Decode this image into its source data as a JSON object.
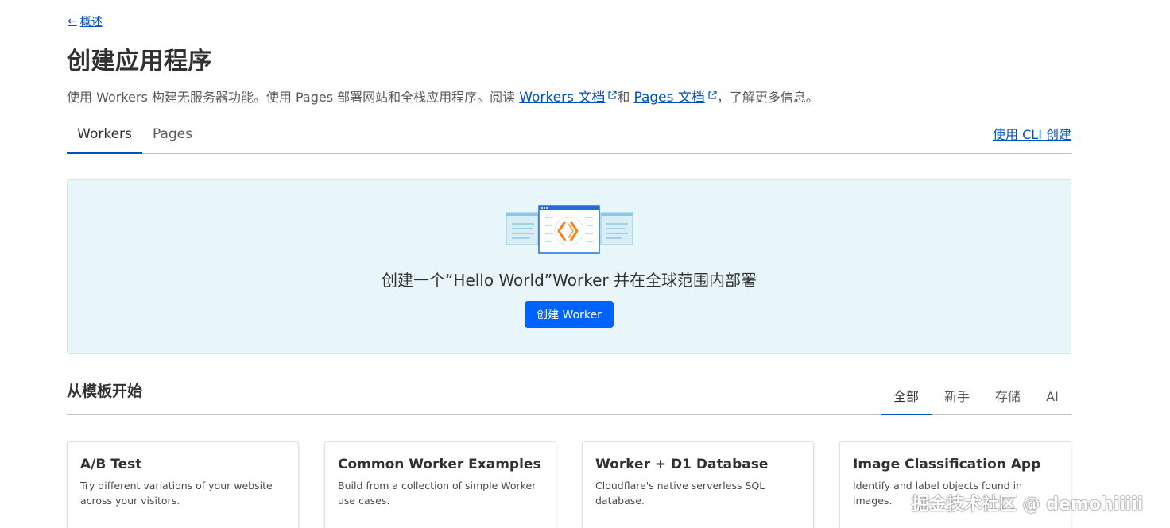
{
  "breadcrumb": {
    "back_label": "概述"
  },
  "page_title": "创建应用程序",
  "intro": {
    "part1": "使用 Workers 构建无服务器功能。使用 Pages 部署网站和全栈应用程序。阅读 ",
    "workers_docs": "Workers 文档",
    "part2": "和 ",
    "pages_docs": "Pages 文档",
    "part3": "，了解更多信息。"
  },
  "tabs": [
    {
      "label": "Workers",
      "active": true
    },
    {
      "label": "Pages",
      "active": false
    }
  ],
  "cli_link": "使用 CLI 创建",
  "hero": {
    "title": "创建一个“Hello World”Worker 并在全球范围内部署",
    "button": "创建 Worker"
  },
  "templates": {
    "heading": "从模板开始",
    "filters": [
      {
        "label": "全部",
        "active": true
      },
      {
        "label": "新手",
        "active": false
      },
      {
        "label": "存储",
        "active": false
      },
      {
        "label": "AI",
        "active": false
      }
    ],
    "cards": [
      {
        "title": "A/B Test",
        "description": "Try different variations of your website across your visitors."
      },
      {
        "title": "Common Worker Examples",
        "description": "Build from a collection of simple Worker use cases."
      },
      {
        "title": "Worker + D1 Database",
        "description": "Cloudflare's native serverless SQL database."
      },
      {
        "title": "Image Classification App",
        "description": "Identify and label objects found in images."
      }
    ]
  },
  "watermark": "掘金技术社区 @ demohiiiii",
  "colors": {
    "link": "#0051c3",
    "primary_button": "#0062ff",
    "hero_bg": "#e8f6fa",
    "accent_orange": "#f6821f"
  },
  "icons": {
    "back": "arrow-left-icon",
    "external": "external-link-icon",
    "hero": "workers-illustration"
  }
}
